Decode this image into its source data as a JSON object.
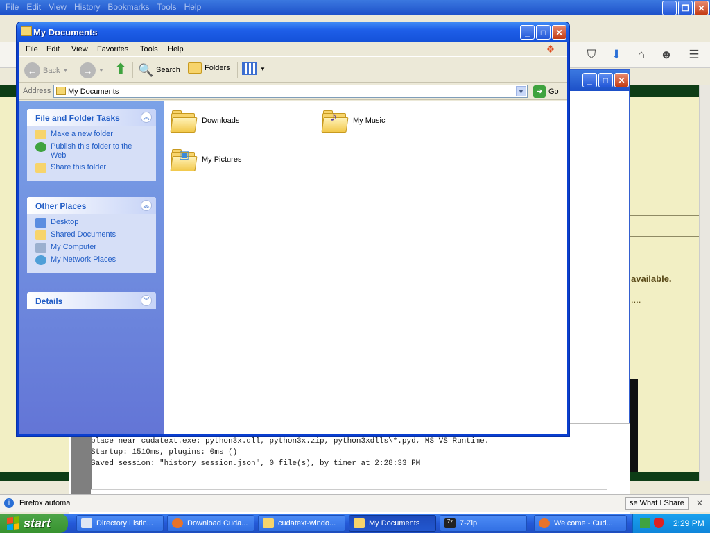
{
  "firefox": {
    "menu": [
      "File",
      "Edit",
      "View",
      "History",
      "Bookmarks",
      "Tools",
      "Help"
    ],
    "console_lines": [
      "place near cudatext.exe: python3x.dll, python3x.zip, python3xdlls\\*.pyd, MS VS Runtime.",
      "Startup: 1510ms, plugins: 0ms ()",
      "Saved session: \"history session.json\", 0 file(s), by timer at 2:28:33 PM"
    ],
    "page_text_1": "available.",
    "page_text_2": "....",
    "status_text": "Firefox automa",
    "share_btn": "se What I Share"
  },
  "window": {
    "title": "My Documents",
    "menu": [
      "File",
      "Edit",
      "View",
      "Favorites",
      "Tools",
      "Help"
    ],
    "toolbar": {
      "back": "Back",
      "search": "Search",
      "folders": "Folders"
    },
    "address": {
      "label": "Address",
      "value": "My Documents",
      "go": "Go"
    },
    "tasks_panel": {
      "title": "File and Folder Tasks",
      "links": [
        "Make a new folder",
        "Publish this folder to the Web",
        "Share this folder"
      ]
    },
    "other_places_panel": {
      "title": "Other Places",
      "links": [
        "Desktop",
        "Shared Documents",
        "My Computer",
        "My Network Places"
      ]
    },
    "details_panel": {
      "title": "Details"
    },
    "items": [
      "Downloads",
      "My Music",
      "My Pictures"
    ]
  },
  "taskbar": {
    "start": "start",
    "tasks": [
      "Directory Listin...",
      "Download Cuda...",
      "cudatext-windo...",
      "My Documents",
      "7-Zip",
      "Welcome - Cud..."
    ],
    "clock": "2:29 PM"
  }
}
